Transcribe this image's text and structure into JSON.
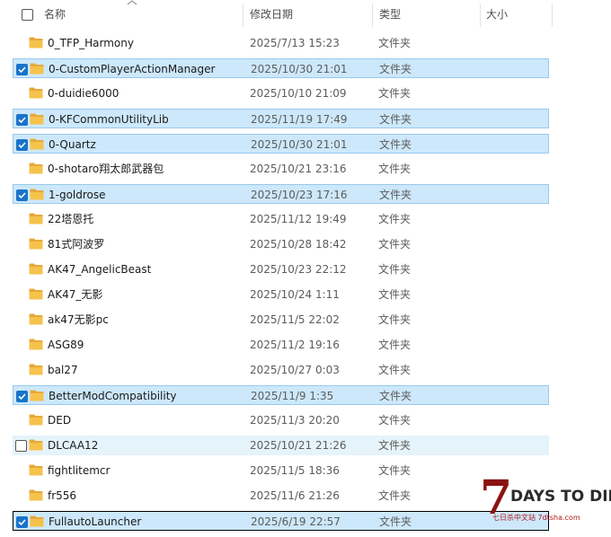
{
  "columns": {
    "name": "名称",
    "modified": "修改日期",
    "type": "类型",
    "size": "大小"
  },
  "rows": [
    {
      "name": "0_TFP_Harmony",
      "modified": "2025/7/13 15:23",
      "type": "文件夹",
      "selected": false
    },
    {
      "name": "0-CustomPlayerActionManager",
      "modified": "2025/10/30 21:01",
      "type": "文件夹",
      "selected": true
    },
    {
      "name": "0-duidie6000",
      "modified": "2025/10/10 21:09",
      "type": "文件夹",
      "selected": false
    },
    {
      "name": "0-KFCommonUtilityLib",
      "modified": "2025/11/19 17:49",
      "type": "文件夹",
      "selected": true
    },
    {
      "name": "0-Quartz",
      "modified": "2025/10/30 21:01",
      "type": "文件夹",
      "selected": true
    },
    {
      "name": "0-shotaro翔太郎武器包",
      "modified": "2025/10/21 23:16",
      "type": "文件夹",
      "selected": false
    },
    {
      "name": "1-goldrose",
      "modified": "2025/10/23 17:16",
      "type": "文件夹",
      "selected": true
    },
    {
      "name": "22塔恩托",
      "modified": "2025/11/12 19:49",
      "type": "文件夹",
      "selected": false
    },
    {
      "name": "81式阿波罗",
      "modified": "2025/10/28 18:42",
      "type": "文件夹",
      "selected": false
    },
    {
      "name": "AK47_AngelicBeast",
      "modified": "2025/10/23 22:12",
      "type": "文件夹",
      "selected": false
    },
    {
      "name": "AK47_无影",
      "modified": "2025/10/24 1:11",
      "type": "文件夹",
      "selected": false
    },
    {
      "name": "ak47无影pc",
      "modified": "2025/11/5 22:02",
      "type": "文件夹",
      "selected": false
    },
    {
      "name": "ASG89",
      "modified": "2025/11/2 19:16",
      "type": "文件夹",
      "selected": false
    },
    {
      "name": "bal27",
      "modified": "2025/10/27 0:03",
      "type": "文件夹",
      "selected": false
    },
    {
      "name": "BetterModCompatibility",
      "modified": "2025/11/9 1:35",
      "type": "文件夹",
      "selected": true
    },
    {
      "name": "DED",
      "modified": "2025/11/3 20:20",
      "type": "文件夹",
      "selected": false
    },
    {
      "name": "DLCAA12",
      "modified": "2025/10/21 21:26",
      "type": "文件夹",
      "selected": false,
      "hover": true
    },
    {
      "name": "fightlitemcr",
      "modified": "2025/11/5 18:36",
      "type": "文件夹",
      "selected": false
    },
    {
      "name": "fr556",
      "modified": "2025/11/6 21:26",
      "type": "文件夹",
      "selected": false
    },
    {
      "name": "FullautoLauncher",
      "modified": "2025/6/19 22:57",
      "type": "文件夹",
      "selected": true,
      "focus": true
    }
  ],
  "watermark": {
    "numeral": "7",
    "title": "DAYS TO DIE",
    "subtitle": "七日杀中文站 7dtsha.com"
  },
  "colors": {
    "selection": "#cde8fb",
    "selection_border": "#99c9ec",
    "hover": "#e5f3fb",
    "checkbox_checked": "#1a73c9",
    "folder": "#f5c24c"
  }
}
